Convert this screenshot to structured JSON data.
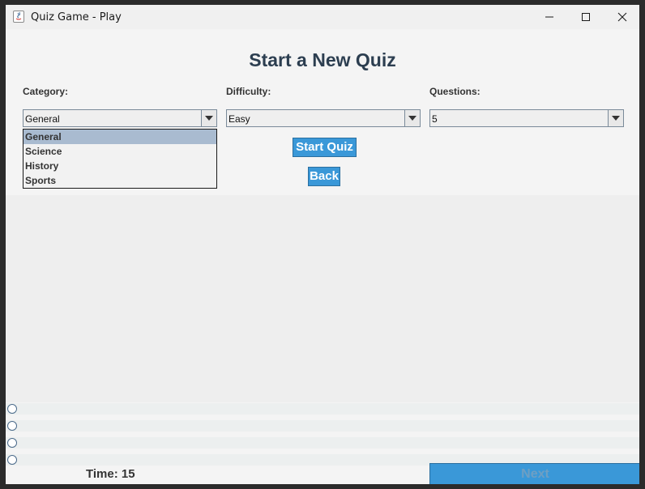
{
  "window": {
    "title": "Quiz Game - Play",
    "accent_color": "#3a98d8",
    "heading_color": "#2c3e50"
  },
  "header": {
    "title": "Start a New Quiz"
  },
  "form": {
    "category": {
      "label": "Category:",
      "value": "General",
      "options": [
        "General",
        "Science",
        "History",
        "Sports"
      ],
      "dropdown_open": true
    },
    "difficulty": {
      "label": "Difficulty:",
      "value": "Easy"
    },
    "questions": {
      "label": "Questions:",
      "value": "5"
    },
    "start_label": "Start Quiz",
    "back_label": "Back"
  },
  "answers": {
    "count": 4
  },
  "footer": {
    "timer": "Time: 15",
    "next_label": "Next",
    "next_enabled": false
  }
}
